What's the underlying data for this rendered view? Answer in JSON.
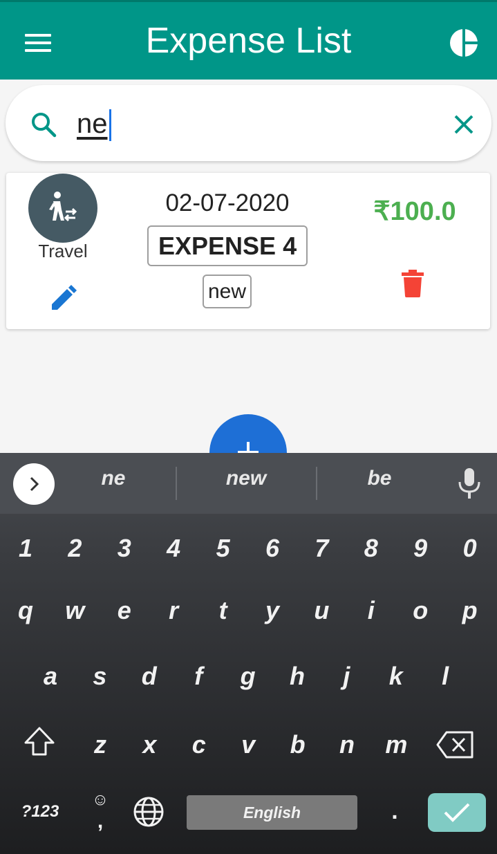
{
  "appbar": {
    "title": "Expense List",
    "color": "#009688"
  },
  "search": {
    "value": "ne"
  },
  "expense": {
    "category": "Travel",
    "date": "02-07-2020",
    "name": "EXPENSE 4",
    "tag": "new",
    "amount": "₹100.0",
    "amount_color": "#4caf50"
  },
  "keyboard": {
    "suggestions": [
      "ne",
      "new",
      "be"
    ],
    "number_row": [
      "1",
      "2",
      "3",
      "4",
      "5",
      "6",
      "7",
      "8",
      "9",
      "0"
    ],
    "row1": [
      "q",
      "w",
      "e",
      "r",
      "t",
      "y",
      "u",
      "i",
      "o",
      "p"
    ],
    "row2": [
      "a",
      "s",
      "d",
      "f",
      "g",
      "h",
      "j",
      "k",
      "l"
    ],
    "row3": [
      "z",
      "x",
      "c",
      "v",
      "b",
      "n",
      "m"
    ],
    "symbols_label": "?123",
    "emoji_label": "☺",
    "comma_label": ",",
    "space_label": "English",
    "period_label": "."
  }
}
